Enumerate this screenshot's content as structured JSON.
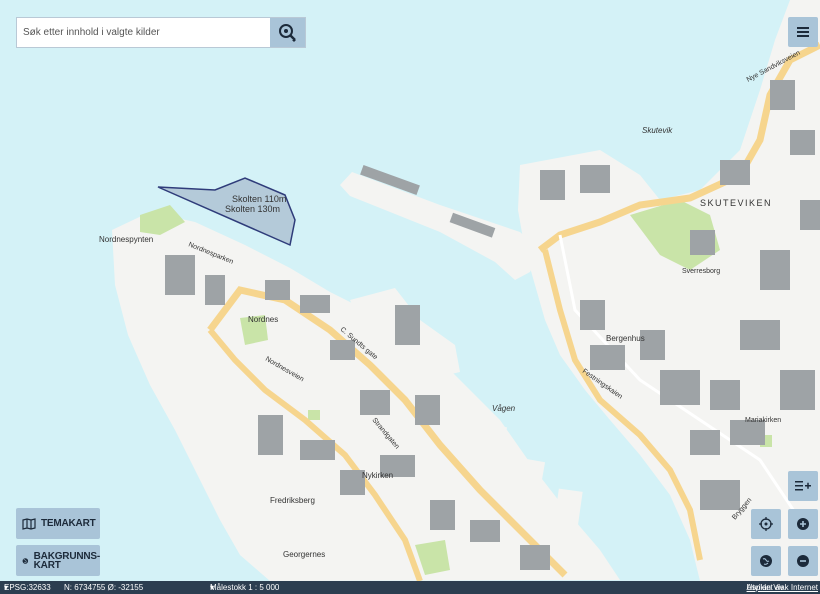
{
  "search": {
    "placeholder": "Søk etter innhold i valgte kilder"
  },
  "buttons": {
    "temakart": "TEMAKART",
    "bakgrunnskart_1": "BAKGRUNNS-",
    "bakgrunnskart_2": "KART"
  },
  "status": {
    "epsg": "EPSG:32633",
    "coords": "N: 6734755 Ø: -32155",
    "scale": "Målestokk 1 : 5 000",
    "credit_prefix": "Utviklet av ",
    "credit_link": "Asplan Viak Internet"
  },
  "map_labels": {
    "skutevik": "Skutevik",
    "skuteviken": "SKUTEVIKEN",
    "vagen": "Vågen",
    "skolten_1": "Skolten 110m",
    "skolten_2": "Skolten 130m",
    "nordnespynten": "Nordnespynten",
    "nordnesparken": "Nordnesparken",
    "nordnes": "Nordnes",
    "nordnesveien": "Nordnesveien",
    "fredriksberg": "Fredriksberg",
    "nykirken": "Nykirken",
    "strandgaten": "Strandgaten",
    "bergenhus": "Bergenhus",
    "festningskaien": "Festningskaien",
    "sverresborg": "Sverresborg",
    "mariakirken": "Mariakirken",
    "nye_sandviksveien": "Nye Sandviksveien",
    "georgernes": "Georgernes",
    "c_sundts_gate": "C. Sundts gate",
    "haugeveien": "Haugeveien",
    "bryggen": "Bryggen"
  },
  "colors": {
    "water": "#d4f2f7",
    "land": "#f4f4f2",
    "building": "#9ea3a6",
    "road": "#f6d58e",
    "park": "#c9e4a8",
    "button": "#a9c4d8",
    "statusbar": "#2c3e50",
    "skolten_outline": "#2f3c7a"
  }
}
